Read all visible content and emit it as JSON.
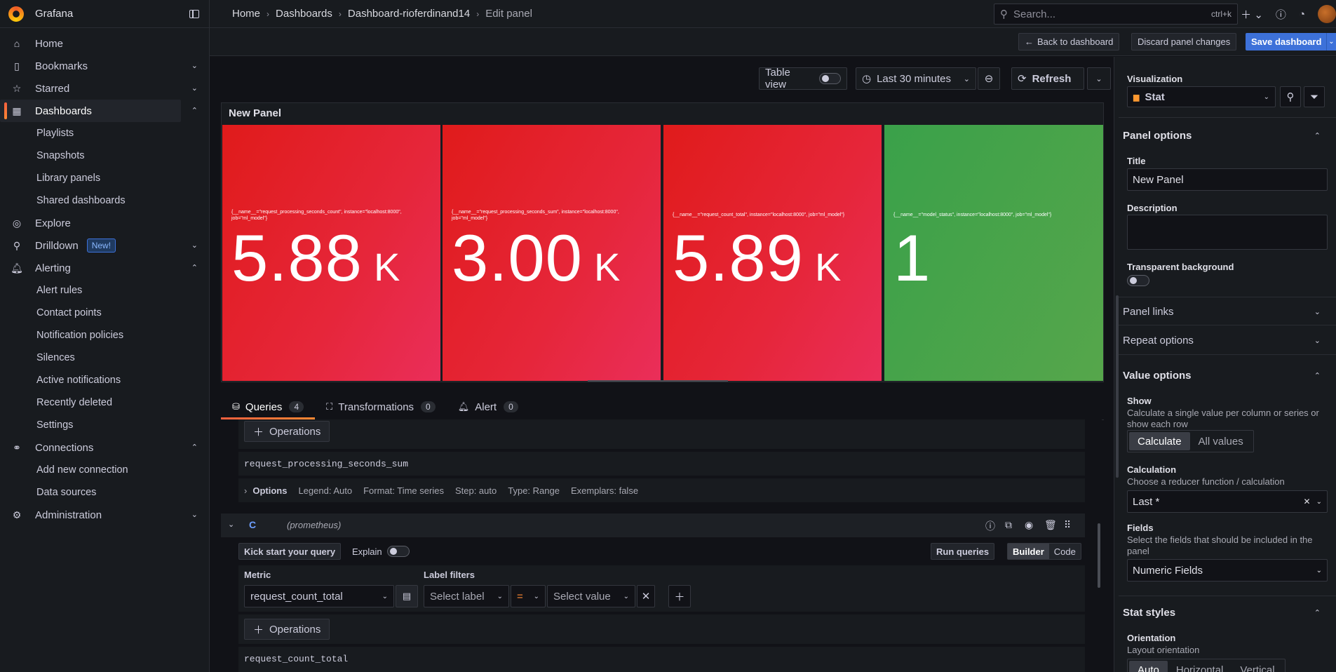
{
  "app": {
    "name": "Grafana"
  },
  "breadcrumbs": [
    "Home",
    "Dashboards",
    "Dashboard-rioferdinand14",
    "Edit panel"
  ],
  "search": {
    "placeholder": "Search...",
    "shortcut": "ctrl+k"
  },
  "sidebar": {
    "items": [
      {
        "label": "Home",
        "icon": "home-icon"
      },
      {
        "label": "Bookmarks",
        "icon": "bookmark-icon"
      },
      {
        "label": "Starred",
        "icon": "star-icon"
      },
      {
        "label": "Dashboards",
        "icon": "apps-icon"
      },
      {
        "label": "Playlists"
      },
      {
        "label": "Snapshots"
      },
      {
        "label": "Library panels"
      },
      {
        "label": "Shared dashboards"
      },
      {
        "label": "Explore",
        "icon": "compass-icon"
      },
      {
        "label": "Drilldown",
        "icon": "microscope-icon",
        "badge": "New!"
      },
      {
        "label": "Alerting",
        "icon": "bell-icon"
      },
      {
        "label": "Alert rules"
      },
      {
        "label": "Contact points"
      },
      {
        "label": "Notification policies"
      },
      {
        "label": "Silences"
      },
      {
        "label": "Active notifications"
      },
      {
        "label": "Recently deleted"
      },
      {
        "label": "Settings"
      },
      {
        "label": "Connections",
        "icon": "connections-icon"
      },
      {
        "label": "Add new connection"
      },
      {
        "label": "Data sources"
      },
      {
        "label": "Administration",
        "icon": "cog-icon"
      }
    ]
  },
  "actions": {
    "back": "Back to dashboard",
    "discard": "Discard panel changes",
    "save": "Save dashboard"
  },
  "panel_toolbar": {
    "table_view": "Table view",
    "time_range": "Last 30 minutes",
    "refresh": "Refresh"
  },
  "panel": {
    "title": "New Panel",
    "stats": [
      {
        "label": "{__name__=\"request_processing_seconds_count\", instance=\"localhost:8000\", job=\"ml_model\"}",
        "value": "5.88",
        "unit": "K",
        "color": "#e02f44"
      },
      {
        "label": "{__name__=\"request_processing_seconds_sum\", instance=\"localhost:8000\", job=\"ml_model\"}",
        "value": "3.00",
        "unit": "K",
        "color": "#e02f44"
      },
      {
        "label": "{__name__=\"request_count_total\", instance=\"localhost:8000\", job=\"ml_model\"}",
        "value": "5.89",
        "unit": "K",
        "color": "#e02f44"
      },
      {
        "label": "{__name__=\"model_status\", instance=\"localhost:8000\", job=\"ml_model\"}",
        "value": "1",
        "unit": "",
        "color": "#56a64b"
      }
    ]
  },
  "query_tabs": [
    {
      "label": "Queries",
      "count": "4"
    },
    {
      "label": "Transformations",
      "count": "0"
    },
    {
      "label": "Alert",
      "count": "0"
    }
  ],
  "query_b": {
    "operations": "Operations",
    "expr": "request_processing_seconds_sum",
    "options_label": "Options",
    "options": [
      "Legend: Auto",
      "Format: Time series",
      "Step: auto",
      "Type: Range",
      "Exemplars: false"
    ]
  },
  "query_c": {
    "ref": "C",
    "datasource": "(prometheus)",
    "kick_start": "Kick start your query",
    "explain": "Explain",
    "run": "Run queries",
    "builder": "Builder",
    "code": "Code",
    "metric_label": "Metric",
    "metric_value": "request_count_total",
    "label_filters": "Label filters",
    "select_label": "Select label",
    "op": "=",
    "select_value": "Select value",
    "operations": "Operations",
    "expr": "request_count_total"
  },
  "options_pane": {
    "visualization_label": "Visualization",
    "visualization": "Stat",
    "panel_options": "Panel options",
    "title_label": "Title",
    "title_value": "New Panel",
    "description_label": "Description",
    "transparent_label": "Transparent background",
    "panel_links": "Panel links",
    "repeat_options": "Repeat options",
    "value_options": "Value options",
    "show_label": "Show",
    "show_desc": "Calculate a single value per column or series or show each row",
    "calculate": "Calculate",
    "all_values": "All values",
    "calculation_label": "Calculation",
    "calculation_desc": "Choose a reducer function / calculation",
    "calculation_value": "Last *",
    "fields_label": "Fields",
    "fields_desc": "Select the fields that should be included in the panel",
    "fields_value": "Numeric Fields",
    "stat_styles": "Stat styles",
    "orientation_label": "Orientation",
    "orientation_desc": "Layout orientation",
    "orientation_options": [
      "Auto",
      "Horizontal",
      "Vertical"
    ]
  }
}
